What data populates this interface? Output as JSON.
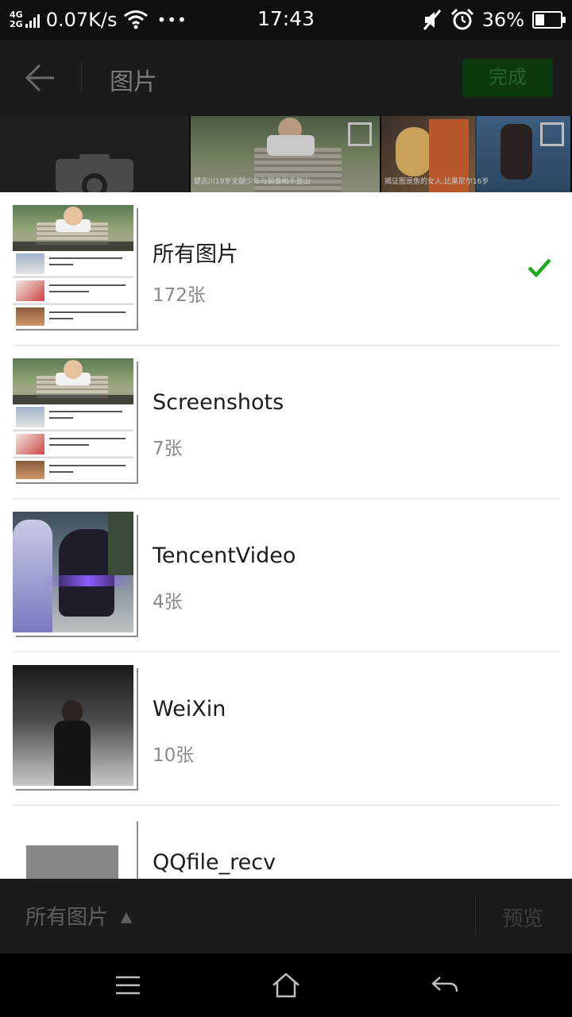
{
  "status_bar": {
    "net_top": "4G",
    "net_bottom": "2G",
    "speed": "0.07K/s",
    "more": "•••",
    "time": "17:43",
    "battery": "36%",
    "battery_level": 0.36
  },
  "header": {
    "title": "图片",
    "done_label": "完成"
  },
  "grid": {
    "captions": [
      "楚志川19岁无腿少年与铜像相手登山",
      "揭证图是鱼的女人,比莱尼尔16岁"
    ]
  },
  "albums": [
    {
      "name": "所有图片",
      "count": "172张",
      "selected": true,
      "cover": "screenshot"
    },
    {
      "name": "Screenshots",
      "count": "7张",
      "selected": false,
      "cover": "screenshot"
    },
    {
      "name": "TencentVideo",
      "count": "4张",
      "selected": false,
      "cover": "video"
    },
    {
      "name": "WeiXin",
      "count": "10张",
      "selected": false,
      "cover": "portrait"
    },
    {
      "name": "QQfile_recv",
      "count": "",
      "selected": false,
      "cover": "gray"
    }
  ],
  "footer": {
    "album_switch_label": "所有图片",
    "preview_label": "预览"
  },
  "icons": {
    "check_color": "#1aad19",
    "done_bg": "#0c3a0e"
  }
}
